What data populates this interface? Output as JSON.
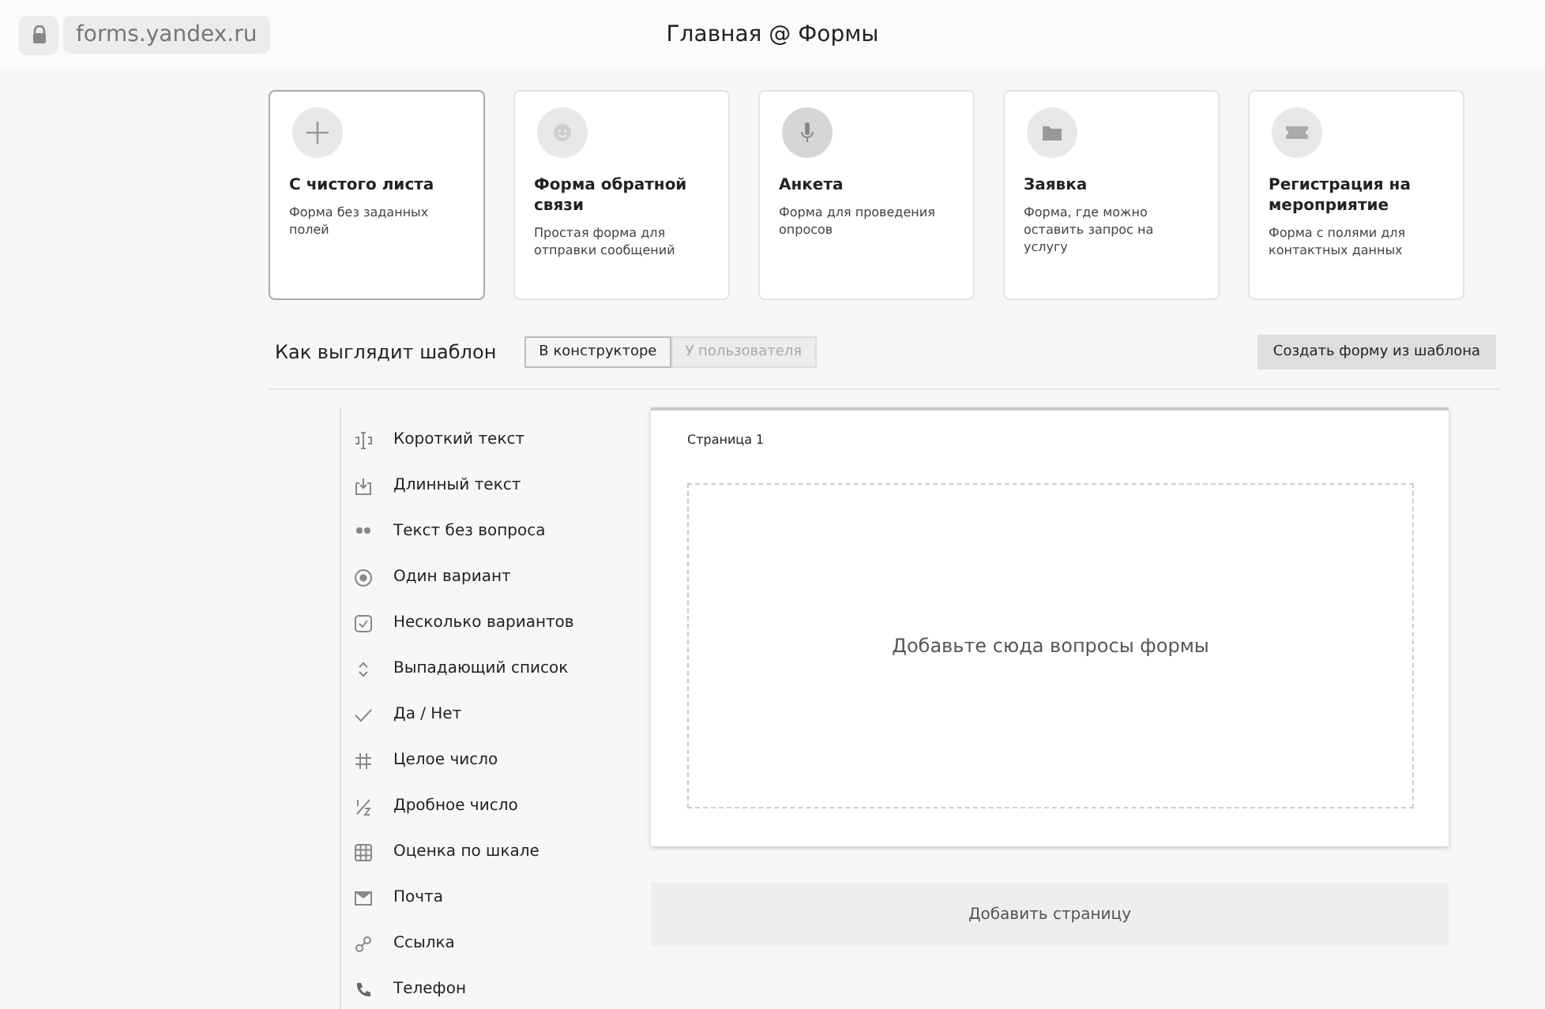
{
  "browser": {
    "url": "forms.yandex.ru",
    "title": "Главная @ Формы"
  },
  "templates": [
    {
      "kind": "plus",
      "title": "С чистого листа",
      "description": "Форма без заданных полей",
      "selected": true
    },
    {
      "kind": "smile",
      "title": "Форма обратной связи",
      "description": "Простая форма для отправки сообщений",
      "selected": false
    },
    {
      "kind": "mic",
      "title": "Анкета",
      "description": "Форма для проведения опросов",
      "selected": false
    },
    {
      "kind": "folder",
      "title": "Заявка",
      "description": "Форма, где можно оставить запрос на услугу",
      "selected": false
    },
    {
      "kind": "ticket",
      "title": "Регистрация на мероприятие",
      "description": "Форма с полями для контактных данных",
      "selected": false
    }
  ],
  "preview": {
    "label": "Как выглядит шаблон",
    "tabs": [
      {
        "label": "В конструкторе",
        "selected": true
      },
      {
        "label": "У пользователя",
        "selected": false
      }
    ],
    "create_button": "Создать форму из шаблона"
  },
  "question_types": [
    {
      "kind": "short",
      "label": "Короткий текст"
    },
    {
      "kind": "long",
      "label": "Длинный текст"
    },
    {
      "kind": "quote",
      "label": "Текст без вопроса"
    },
    {
      "kind": "radio",
      "label": "Один вариант"
    },
    {
      "kind": "checkbox",
      "label": "Несколько вариантов"
    },
    {
      "kind": "select",
      "label": "Выпадающий список"
    },
    {
      "kind": "yesno",
      "label": "Да / Нет"
    },
    {
      "kind": "integer",
      "label": "Целое число"
    },
    {
      "kind": "fraction",
      "label": "Дробное число"
    },
    {
      "kind": "scale",
      "label": "Оценка по шкале"
    },
    {
      "kind": "mail",
      "label": "Почта"
    },
    {
      "kind": "link",
      "label": "Ссылка"
    },
    {
      "kind": "phone",
      "label": "Телефон"
    }
  ],
  "page": {
    "title": "Страница 1",
    "dropzone": "Добавьте сюда вопросы формы",
    "add_page_button": "Добавить страницу"
  }
}
